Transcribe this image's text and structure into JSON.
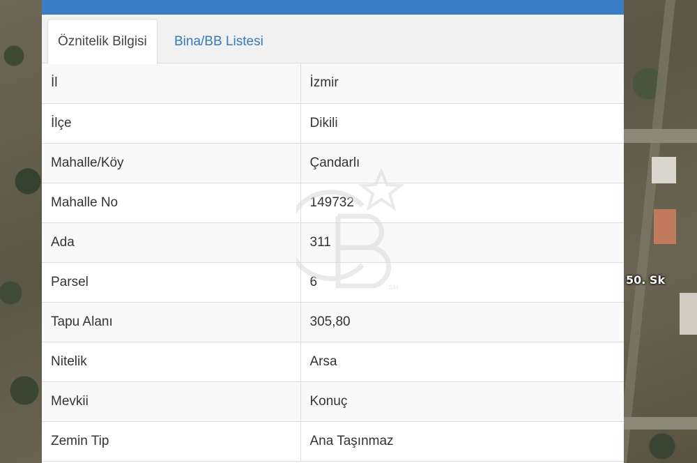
{
  "tabs": [
    {
      "label": "Öznitelik Bilgisi",
      "active": true
    },
    {
      "label": "Bina/BB Listesi",
      "active": false
    }
  ],
  "rows": [
    {
      "key": "İl",
      "value": "İzmir"
    },
    {
      "key": "İlçe",
      "value": "Dikili"
    },
    {
      "key": "Mahalle/Köy",
      "value": "Çandarlı"
    },
    {
      "key": "Mahalle No",
      "value": "149732"
    },
    {
      "key": "Ada",
      "value": "311"
    },
    {
      "key": "Parsel",
      "value": "6"
    },
    {
      "key": "Tapu Alanı",
      "value": "305,80"
    },
    {
      "key": "Nitelik",
      "value": "Arsa"
    },
    {
      "key": "Mevkii",
      "value": "Konuç"
    },
    {
      "key": "Zemin Tip",
      "value": "Ana Taşınmaz"
    }
  ],
  "map": {
    "street_label": "50. Sk"
  },
  "watermark": {
    "logo_text": "CB",
    "mark": "SM"
  },
  "colors": {
    "header": "#3a7fc6",
    "link": "#337ab7",
    "border": "#dddddd",
    "stripe": "#f9f9f9"
  }
}
